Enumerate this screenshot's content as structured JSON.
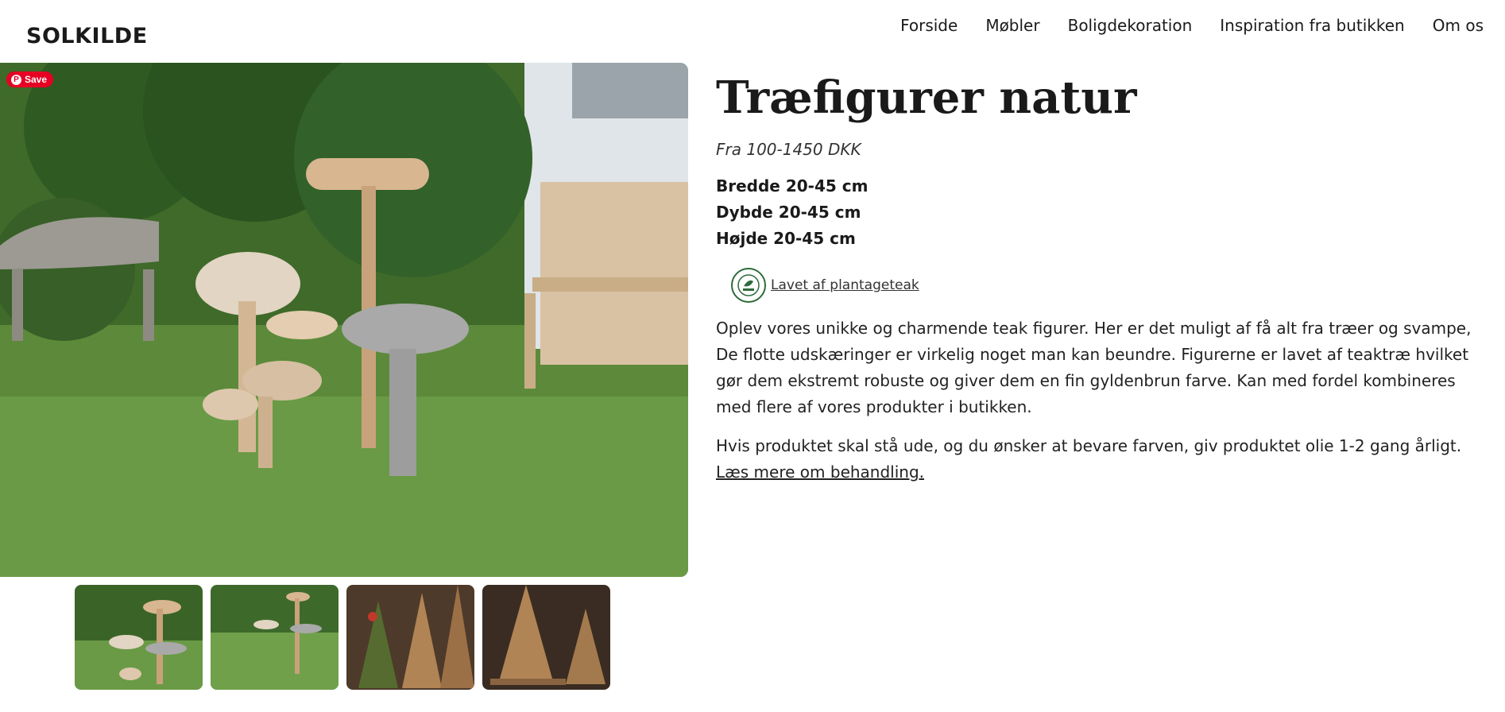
{
  "header": {
    "logo": "SOLKILDE",
    "nav": [
      "Forside",
      "Møbler",
      "Boligdekoration",
      "Inspiration fra butikken",
      "Om os"
    ]
  },
  "gallery": {
    "pin_save_label": "Save",
    "thumbnail_count": 4
  },
  "product": {
    "title": "Træfigurer natur",
    "price": "Fra 100-1450 DKK",
    "dimensions": [
      "Bredde 20-45 cm",
      "Dybde 20-45 cm",
      "Højde 20-45 cm"
    ],
    "badge_icon": "legal-teak-seal-icon",
    "badge_link": "Lavet af plantageteak",
    "description": "Oplev vores unikke og charmende teak figurer. Her er det muligt af få alt fra træer og svampe, De flotte udskæringer er virkelig noget man kan beundre. Figurerne er lavet af teaktræ hvilket gør dem ekstremt robuste og giver dem en fin gyldenbrun farve. Kan med fordel kombineres med flere af vores produkter i butikken.",
    "care_text": "Hvis produktet skal stå ude, og du ønsker at bevare farven, giv produktet olie 1-2 gang årligt. ",
    "care_link": "Læs mere om behandling."
  },
  "colors": {
    "pinterest_red": "#e60023",
    "badge_green": "#2e6b3a"
  }
}
